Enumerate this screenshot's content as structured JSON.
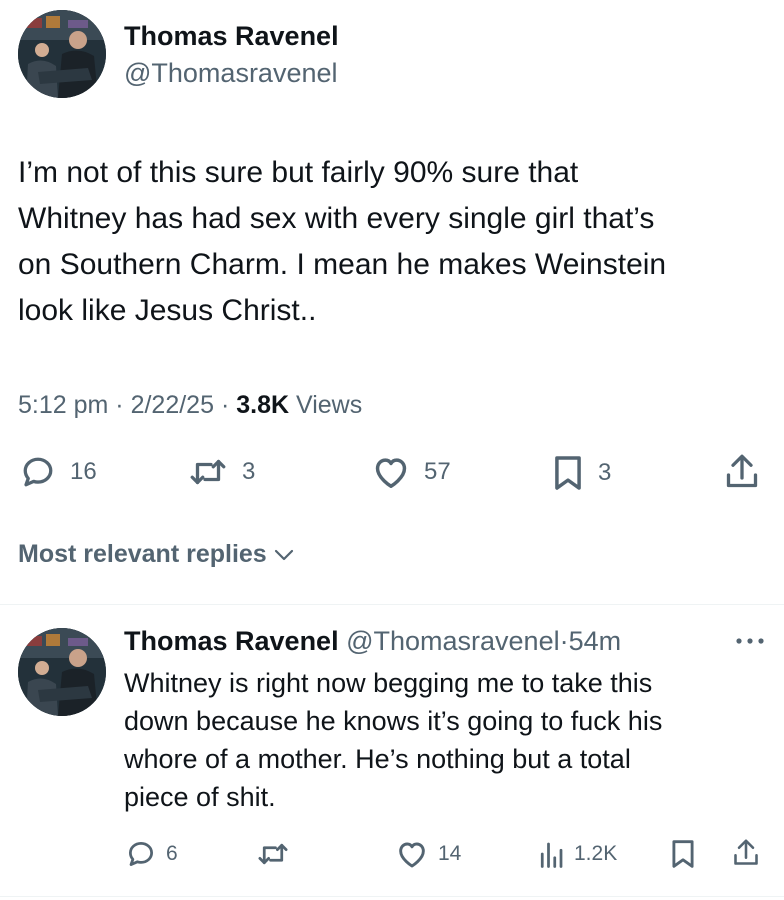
{
  "tweet": {
    "author_name": "Thomas Ravenel",
    "author_handle": "@Thomasravenel",
    "text": "I’m not of this sure but fairly 90% sure that\nWhitney has had sex with every single girl that’s\non Southern Charm. I mean he makes Weinstein\nlook like Jesus Christ..",
    "time": "5:12 pm",
    "date": "2/22/25",
    "views_count": "3.8K",
    "views_label": "Views",
    "sep": "·",
    "replies": "16",
    "reposts": "3",
    "likes": "57",
    "bookmarks": "3"
  },
  "replies_section": {
    "label": "Most relevant replies"
  },
  "reply": {
    "author_name": "Thomas Ravenel",
    "author_handle": "@Thomasravenel",
    "time_ago": "54m",
    "sep": "·",
    "text": "Whitney is right now begging me to take this\ndown because he knows it’s going to fuck his\nwhore of a mother. He’s nothing but a total\npiece of shit.",
    "replies": "6",
    "likes": "14",
    "views": "1.2K"
  },
  "colors": {
    "text": "#0f1419",
    "secondary": "#536471",
    "divider": "#eff3f4"
  }
}
